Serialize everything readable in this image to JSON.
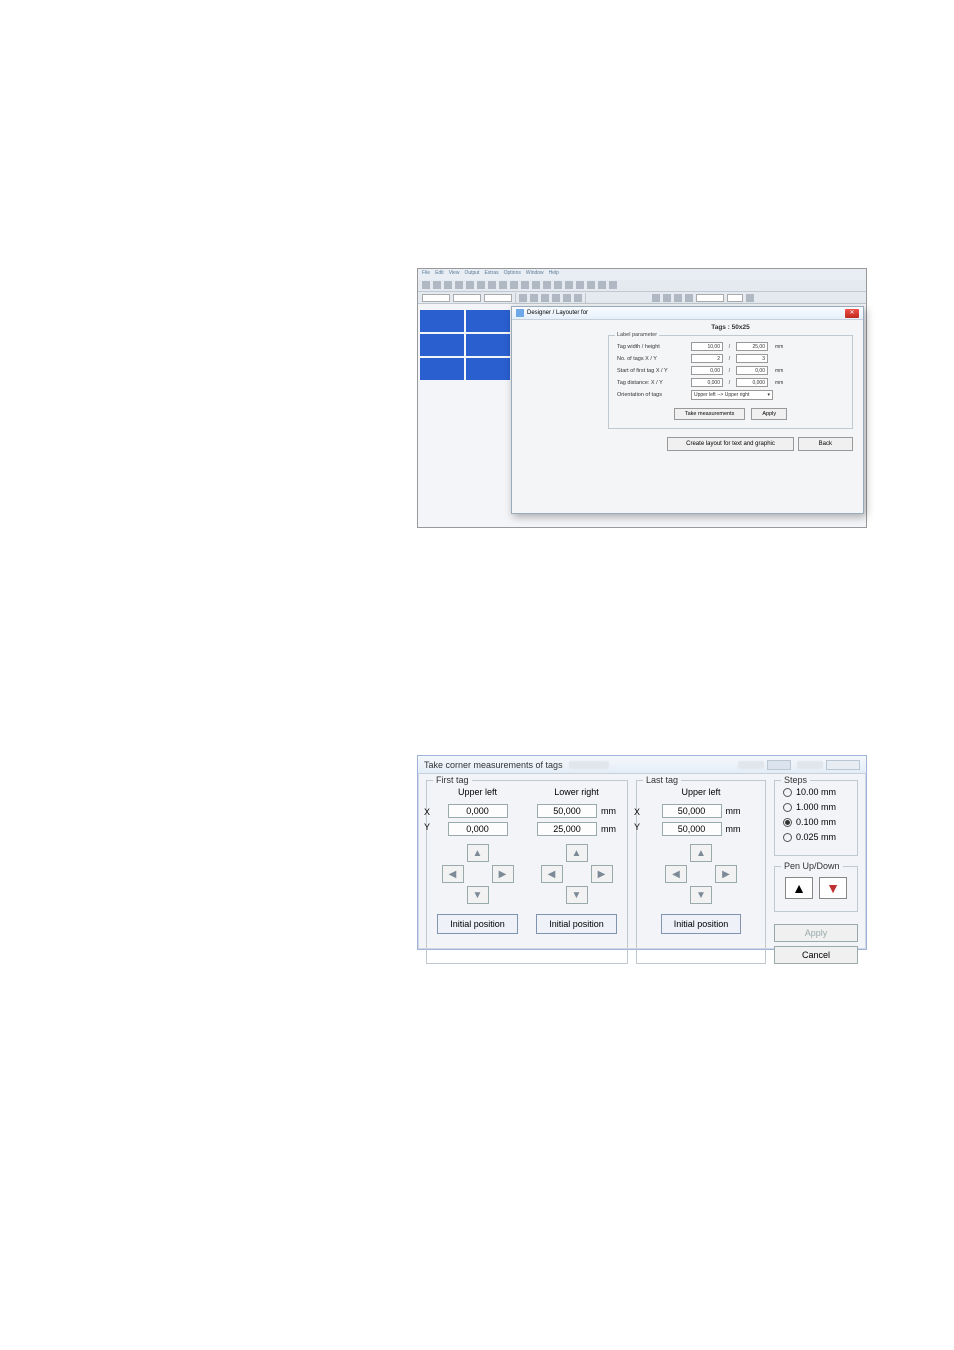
{
  "img1": {
    "menu": [
      "File",
      "Edit",
      "View",
      "Output",
      "Extras",
      "Options",
      "Window",
      "Help"
    ],
    "dialog": {
      "title": "Designer / Layouter for",
      "heading": "Tags : 50x25",
      "legend": "Label parameter",
      "rows": {
        "tagwh": {
          "label": "Tag width / height",
          "x": "10,00",
          "y": "25,00",
          "unit": "mm"
        },
        "notags": {
          "label": "No. of tags X / Y",
          "x": "2",
          "y": "3",
          "unit": ""
        },
        "start": {
          "label": "Start of first tag X / Y",
          "x": "0,00",
          "y": "0,00",
          "unit": "mm"
        },
        "dist": {
          "label": "Tag distance: X / Y",
          "x": "0,000",
          "y": "0,000",
          "unit": "mm"
        },
        "orient": {
          "label": "Orientation of tags",
          "value": "Upper left --> Upper right"
        }
      },
      "buttons": {
        "take": "Take measurements",
        "apply": "Apply",
        "create": "Create layout for text and graphic",
        "back": "Back"
      }
    }
  },
  "img2": {
    "title": "Take corner measurements of tags",
    "first": {
      "legend": "First tag",
      "upperleft": "Upper left",
      "lowerright": "Lower right",
      "ulX": "0,000",
      "ulY": "0,000",
      "lrX": "50,000",
      "lrY": "25,000",
      "mm": "mm",
      "init": "Initial position"
    },
    "last": {
      "legend": "Last tag",
      "upperleft": "Upper left",
      "x": "50,000",
      "y": "50,000",
      "mm": "mm",
      "init": "Initial position"
    },
    "steps": {
      "legend": "Steps",
      "o1": "10.00 mm",
      "o2": "1.000 mm",
      "o3": "0.100 mm",
      "o4": "0.025 mm"
    },
    "pen": {
      "legend": "Pen Up/Down"
    },
    "apply": "Apply",
    "cancel": "Cancel",
    "X": "X",
    "Y": "Y"
  }
}
